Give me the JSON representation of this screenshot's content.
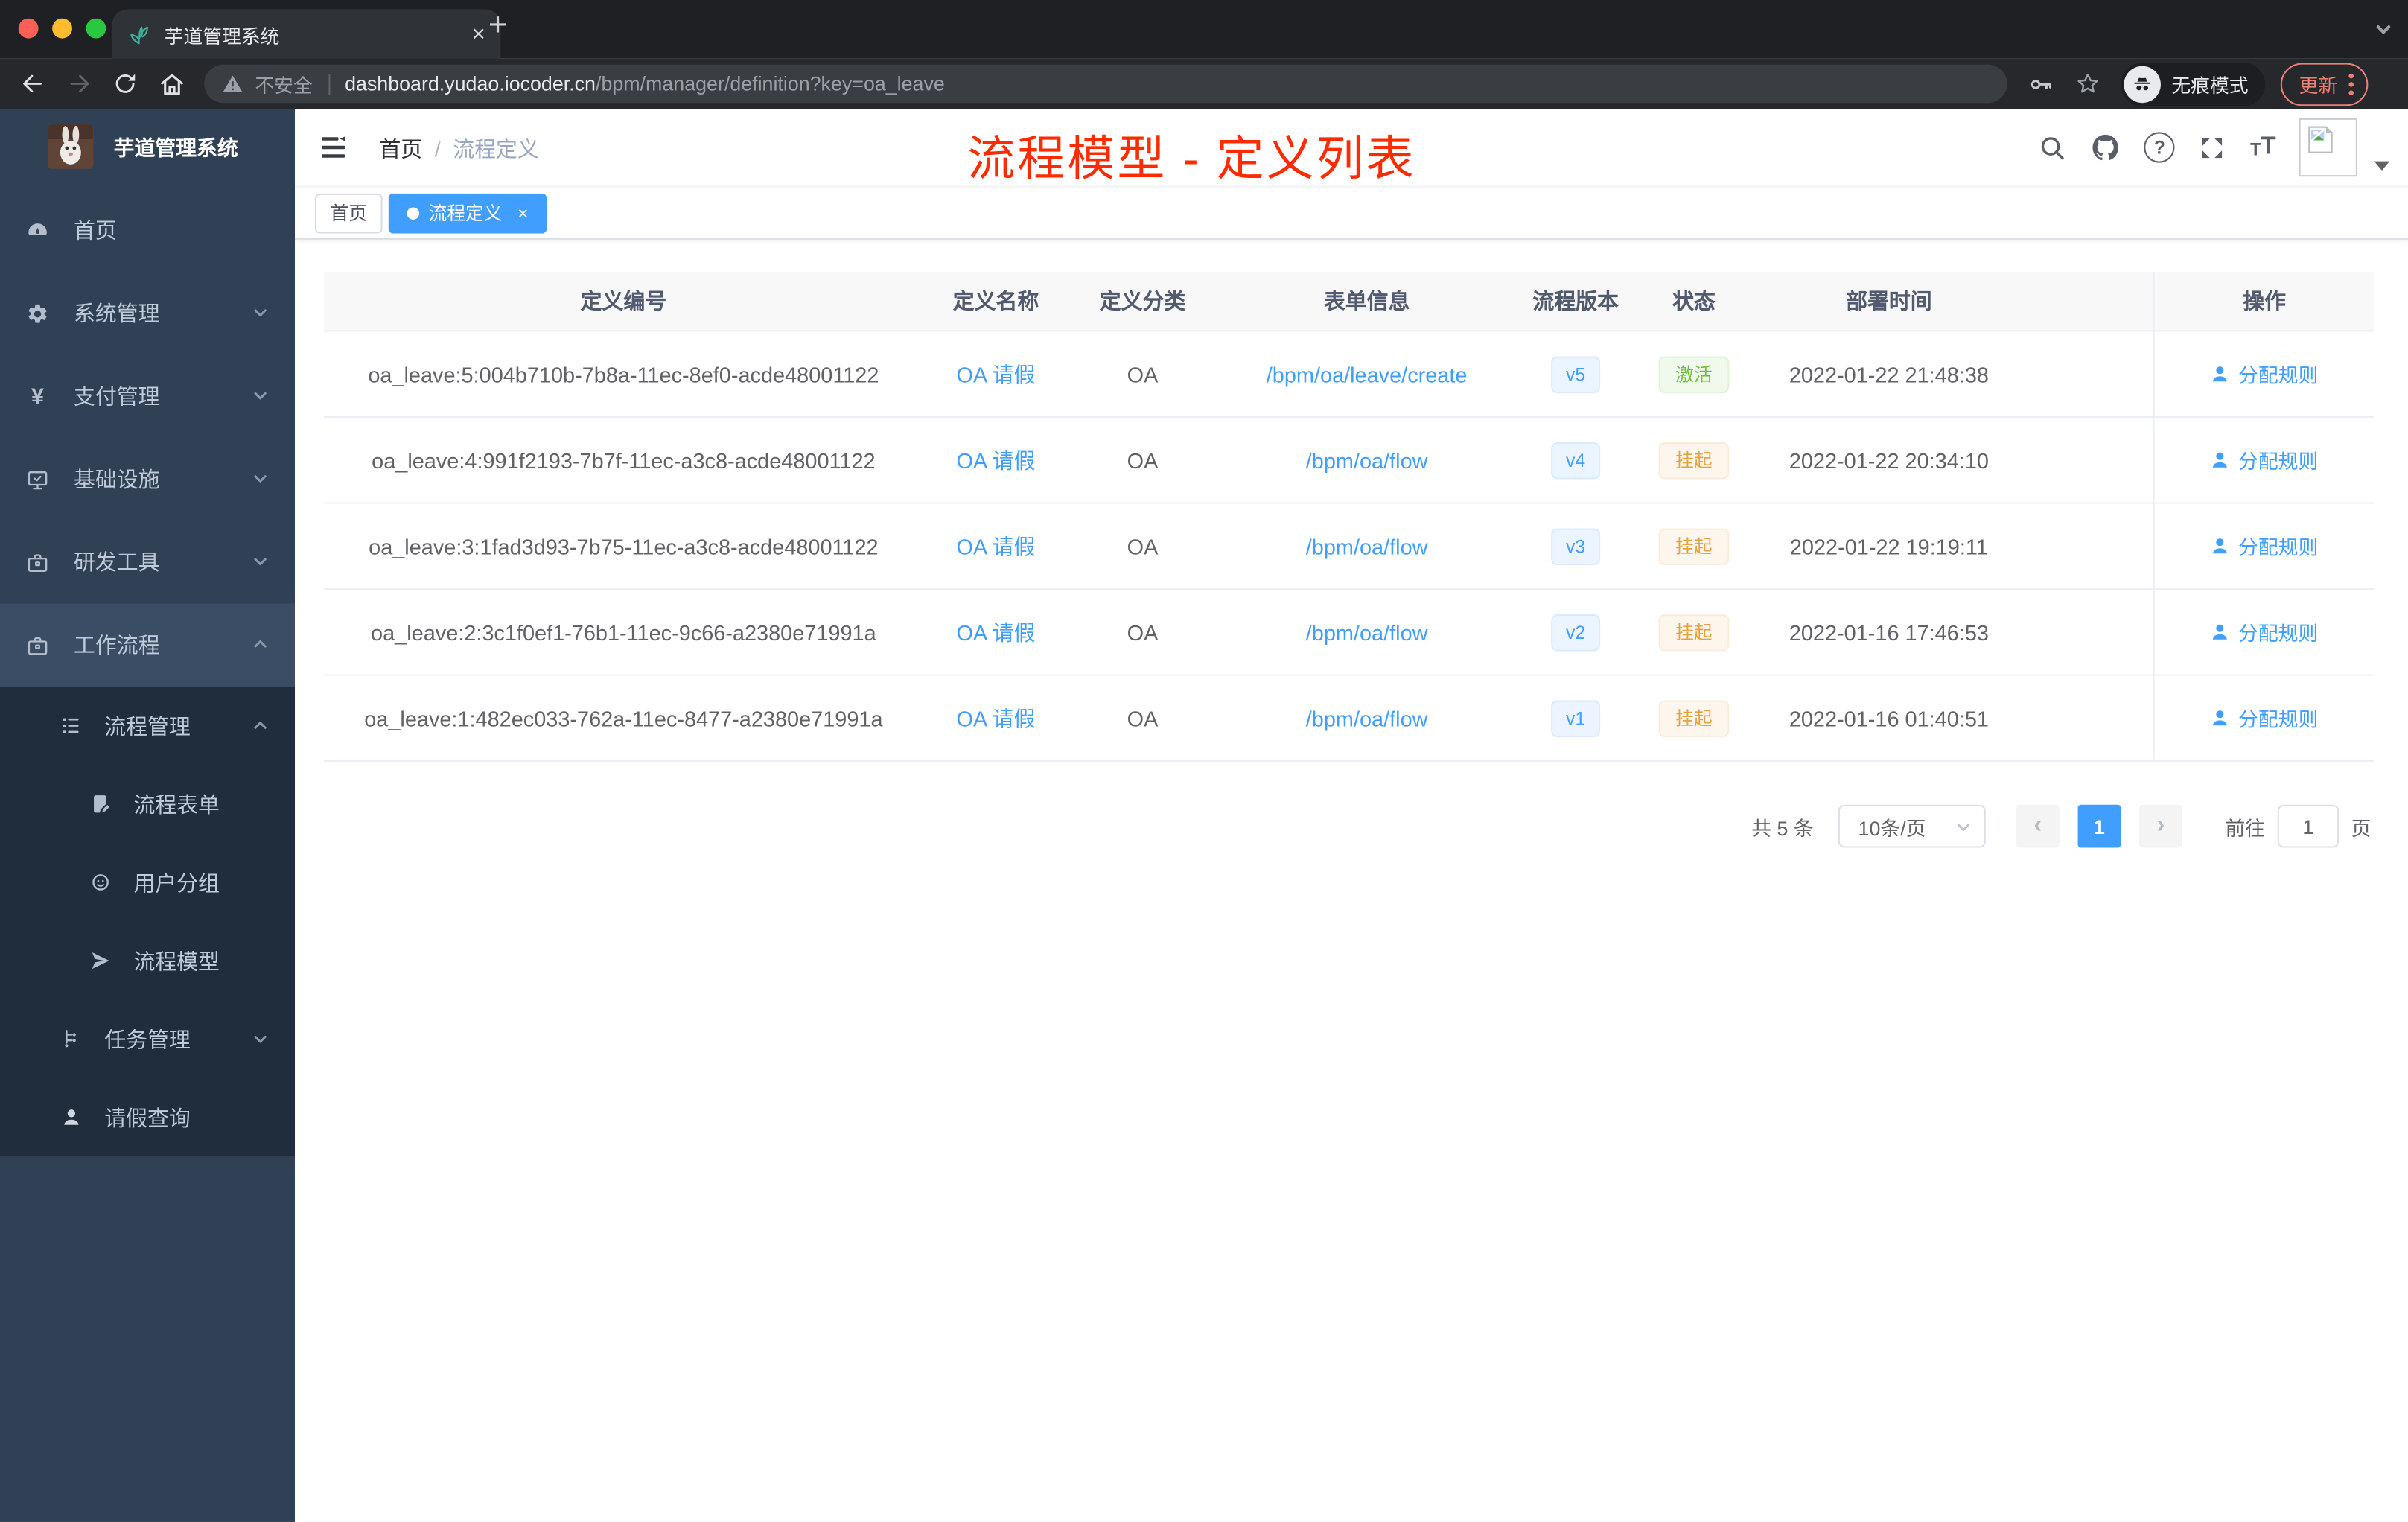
{
  "browser": {
    "tab_title": "芋道管理系统",
    "tab_close_label": "×",
    "new_tab_label": "+",
    "address": {
      "warning_label": "不安全",
      "url_domain": "dashboard.yudao.iocoder.cn",
      "url_path": "/bpm/manager/definition?key=oa_leave"
    },
    "incognito_label": "无痕模式",
    "update_label": "更新"
  },
  "sidebar": {
    "app_title": "芋道管理系统",
    "items": [
      {
        "label": "首页",
        "icon": "dashboard-icon"
      },
      {
        "label": "系统管理",
        "icon": "gear-icon",
        "arrow": "down"
      },
      {
        "label": "支付管理",
        "icon": "yen-icon",
        "arrow": "down"
      },
      {
        "label": "基础设施",
        "icon": "monitor-icon",
        "arrow": "down"
      },
      {
        "label": "研发工具",
        "icon": "briefcase-icon",
        "arrow": "down"
      },
      {
        "label": "工作流程",
        "icon": "briefcase-icon",
        "arrow": "up"
      }
    ],
    "submenu": [
      {
        "label": "流程管理",
        "icon": "list-icon",
        "arrow": "up",
        "level": 1
      },
      {
        "label": "流程表单",
        "icon": "form-icon",
        "level": 2
      },
      {
        "label": "用户分组",
        "icon": "user-group-icon",
        "level": 2
      },
      {
        "label": "流程模型",
        "icon": "paper-plane-icon",
        "level": 2
      },
      {
        "label": "任务管理",
        "icon": "tree-icon",
        "arrow": "down",
        "level": 1
      },
      {
        "label": "请假查询",
        "icon": "person-icon",
        "level": 1
      }
    ]
  },
  "navbar": {
    "breadcrumb": {
      "home": "首页",
      "separator": "/",
      "current": "流程定义"
    },
    "annotation_title": "流程模型 - 定义列表"
  },
  "tags": {
    "home_label": "首页",
    "active_label": "流程定义",
    "close_label": "×"
  },
  "table": {
    "headers": [
      "定义编号",
      "定义名称",
      "定义分类",
      "表单信息",
      "流程版本",
      "状态",
      "部署时间",
      "操作"
    ],
    "rows": [
      {
        "id": "oa_leave:5:004b710b-7b8a-11ec-8ef0-acde48001122",
        "name": "OA 请假",
        "category": "OA",
        "form": "/bpm/oa/leave/create",
        "version": "v5",
        "status": "激活",
        "status_type": "success",
        "time": "2022-01-22 21:48:38",
        "action": "分配规则"
      },
      {
        "id": "oa_leave:4:991f2193-7b7f-11ec-a3c8-acde48001122",
        "name": "OA 请假",
        "category": "OA",
        "form": "/bpm/oa/flow",
        "version": "v4",
        "status": "挂起",
        "status_type": "warning",
        "time": "2022-01-22 20:34:10",
        "action": "分配规则"
      },
      {
        "id": "oa_leave:3:1fad3d93-7b75-11ec-a3c8-acde48001122",
        "name": "OA 请假",
        "category": "OA",
        "form": "/bpm/oa/flow",
        "version": "v3",
        "status": "挂起",
        "status_type": "warning",
        "time": "2022-01-22 19:19:11",
        "action": "分配规则"
      },
      {
        "id": "oa_leave:2:3c1f0ef1-76b1-11ec-9c66-a2380e71991a",
        "name": "OA 请假",
        "category": "OA",
        "form": "/bpm/oa/flow",
        "version": "v2",
        "status": "挂起",
        "status_type": "warning",
        "time": "2022-01-16 17:46:53",
        "action": "分配规则"
      },
      {
        "id": "oa_leave:1:482ec033-762a-11ec-8477-a2380e71991a",
        "name": "OA 请假",
        "category": "OA",
        "form": "/bpm/oa/flow",
        "version": "v1",
        "status": "挂起",
        "status_type": "warning",
        "time": "2022-01-16 01:40:51",
        "action": "分配规则"
      }
    ]
  },
  "pagination": {
    "total_label": "共 5 条",
    "page_size_label": "10条/页",
    "prev_label": "‹",
    "current_page": "1",
    "next_label": "›",
    "goto_label": "前往",
    "goto_value": "1",
    "unit_label": "页"
  },
  "colors": {
    "accent": "#409eff",
    "annotation_red": "#fe2b00",
    "success": "#67c23a",
    "warning": "#e6a23c",
    "sidebar_bg": "#304156",
    "submenu_bg": "#1f2d3d",
    "update_red": "#ee7f73"
  }
}
